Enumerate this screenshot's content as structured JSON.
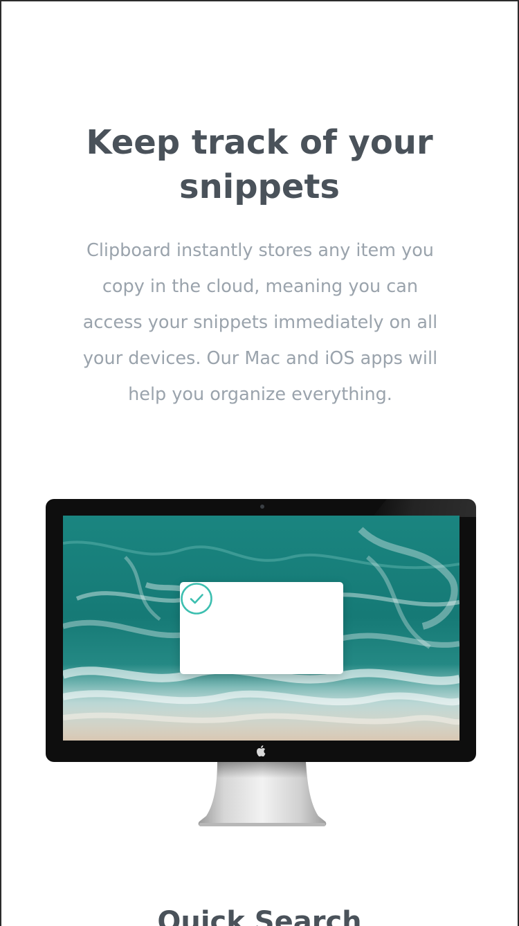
{
  "features": {
    "title_line1": "Keep track of your",
    "title_line2": "snippets",
    "description_lines": [
      "Clipboard instantly stores any item you",
      "copy in the cloud, meaning you can",
      "access your snippets immediately on all",
      "your devices. Our Mac and iOS apps will",
      "help you organize everything."
    ],
    "next_heading": "Quick Search"
  },
  "colors": {
    "heading": "#4a525a",
    "body_text": "#9aa3ac",
    "accent": "#3dbfb0",
    "bezel": "#0e0e0e"
  },
  "icons": {
    "dialog": "check-circle-icon",
    "monitor_badge": "apple-logo-icon"
  }
}
